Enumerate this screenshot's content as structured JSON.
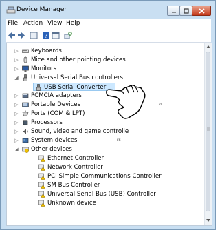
{
  "window": {
    "title": "Device Manager"
  },
  "menu": [
    {
      "label": "File"
    },
    {
      "label": "Action"
    },
    {
      "label": "View"
    },
    {
      "label": "Help"
    }
  ],
  "tree": [
    {
      "label": "Keyboards",
      "icon": "keyboard-icon",
      "expander": "▷",
      "indent": 0
    },
    {
      "label": "Mice and other pointing devices",
      "icon": "mouse-icon",
      "expander": "▷",
      "indent": 0
    },
    {
      "label": "Monitors",
      "icon": "monitor-icon",
      "expander": "▷",
      "indent": 0
    },
    {
      "label": "Universal Serial Bus controllers",
      "icon": "usb-icon",
      "expander": "◢",
      "indent": 0
    },
    {
      "label": "USB Serial Converter",
      "icon": "usb-icon",
      "expander": "",
      "indent": 1,
      "selected": true
    },
    {
      "label": "PCMCIA adapters",
      "icon": "pcmcia-icon",
      "expander": "▷",
      "indent": 0
    },
    {
      "label": "Portable Devices",
      "icon": "portable-device-icon",
      "expander": "▷",
      "indent": 0
    },
    {
      "label": "Ports (COM & LPT)",
      "icon": "port-icon",
      "expander": "▷",
      "indent": 0
    },
    {
      "label": "Processors",
      "icon": "processor-icon",
      "expander": "▷",
      "indent": 0
    },
    {
      "label": "Sound, video and game controlle",
      "icon": "sound-icon",
      "expander": "▷",
      "indent": 0
    },
    {
      "label": "System devices",
      "icon": "system-icon",
      "expander": "▷",
      "indent": 0
    },
    {
      "label": "Other devices",
      "icon": "other-devices-icon",
      "expander": "◢",
      "indent": 0
    },
    {
      "label": "Ethernet Controller",
      "icon": "unknown-device-icon",
      "expander": "",
      "indent": 1
    },
    {
      "label": "Network Controller",
      "icon": "unknown-device-icon",
      "expander": "",
      "indent": 1
    },
    {
      "label": "PCI Simple Communications Controller",
      "icon": "unknown-device-icon",
      "expander": "",
      "indent": 1
    },
    {
      "label": "SM Bus Controller",
      "icon": "unknown-device-icon",
      "expander": "",
      "indent": 1
    },
    {
      "label": "Universal Serial Bus (USB) Controller",
      "icon": "unknown-device-icon",
      "expander": "",
      "indent": 1
    },
    {
      "label": "Unknown device",
      "icon": "unknown-device-icon",
      "expander": "",
      "indent": 1
    }
  ],
  "stray_text": {
    "a": "rs",
    "b": "ᵈ"
  },
  "colors": {
    "selection": "#cce8ff",
    "warning": "#f2c200"
  }
}
